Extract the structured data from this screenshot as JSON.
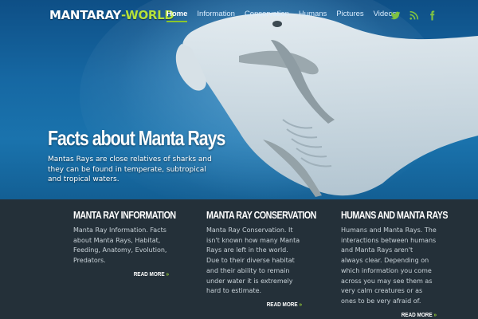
{
  "site": {
    "logo_part1": "MANTARAY",
    "logo_part2": "-WORLD"
  },
  "nav": {
    "items": [
      {
        "label": "Home",
        "active": true
      },
      {
        "label": "Information",
        "active": false
      },
      {
        "label": "Conservation",
        "active": false
      },
      {
        "label": "Humans",
        "active": false
      },
      {
        "label": "Pictures",
        "active": false
      },
      {
        "label": "Videos",
        "active": false
      }
    ]
  },
  "social": {
    "icons": [
      "twitter-icon",
      "rss-icon",
      "facebook-icon"
    ],
    "colors": {
      "twitter": "#7fc242",
      "rss": "#7fc242",
      "facebook": "#7fc242"
    }
  },
  "hero": {
    "title": "Facts about Manta Rays",
    "text": "Mantas Rays are close relatives of sharks and they can be found in temperate, subtropical and tropical waters."
  },
  "columns": [
    {
      "heading": "MANTA RAY INFORMATION",
      "text": "Manta Ray Information. Facts about Manta Rays, Habitat, Feeding, Anatomy, Evolution, Predators.",
      "more": "READ MORE"
    },
    {
      "heading": "MANTA RAY CONSERVATION",
      "text": "Manta Ray Conservation. It isn't known how many Manta Rays are left in the world. Due to their diverse habitat and their ability to remain under water it is extremely hard to estimate.",
      "more": "READ MORE"
    },
    {
      "heading": "HUMANS AND MANTA RAYS",
      "text": "Humans and Manta Rays. The interactions between humans and Manta Rays aren't always clear. Depending on which information you come across you may see them as very calm creatures or as ones to be very afraid of.",
      "more": "READ MORE"
    }
  ],
  "colors": {
    "accent": "#8ac52d",
    "footer_bg": "#243039",
    "ocean": "#1668a3"
  }
}
